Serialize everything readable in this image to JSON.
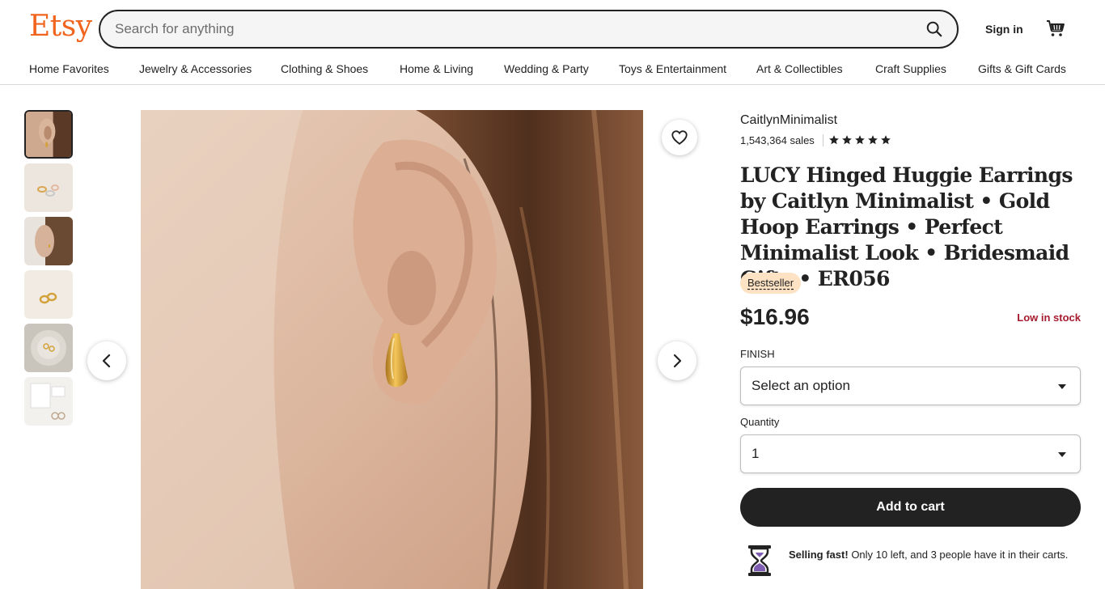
{
  "header": {
    "logo": "Etsy",
    "search_placeholder": "Search for anything",
    "sign_in": "Sign in"
  },
  "nav": {
    "items": [
      "Home Favorites",
      "Jewelry & Accessories",
      "Clothing & Shoes",
      "Home & Living",
      "Wedding & Party",
      "Toys & Entertainment",
      "Art & Collectibles",
      "Craft Supplies",
      "Gifts & Gift Cards"
    ]
  },
  "gallery": {
    "thumbnail_count": 6,
    "active_index": 0
  },
  "listing": {
    "shop_name": "CaitlynMinimalist",
    "sales": "1,543,364 sales",
    "rating": 5,
    "title": "LUCY Hinged Huggie Earrings by Caitlyn Minimalist • Gold Hoop Earrings • Perfect Minimalist Look • Bridesmaid Gifts • ER056",
    "badge": "Bestseller",
    "price": "$16.96",
    "stock_status": "Low in stock",
    "finish_label": "FINISH",
    "finish_value": "Select an option",
    "quantity_label": "Quantity",
    "quantity_value": "1",
    "add_to_cart": "Add to cart",
    "selling_fast_bold": "Selling fast!",
    "selling_fast_text": "Only 10 left, and 3 people have it in their carts."
  },
  "colors": {
    "brand": "#f1641e",
    "stock_red": "#a61a2e",
    "badge_bg": "#fde3c4",
    "button_dark": "#222222"
  }
}
